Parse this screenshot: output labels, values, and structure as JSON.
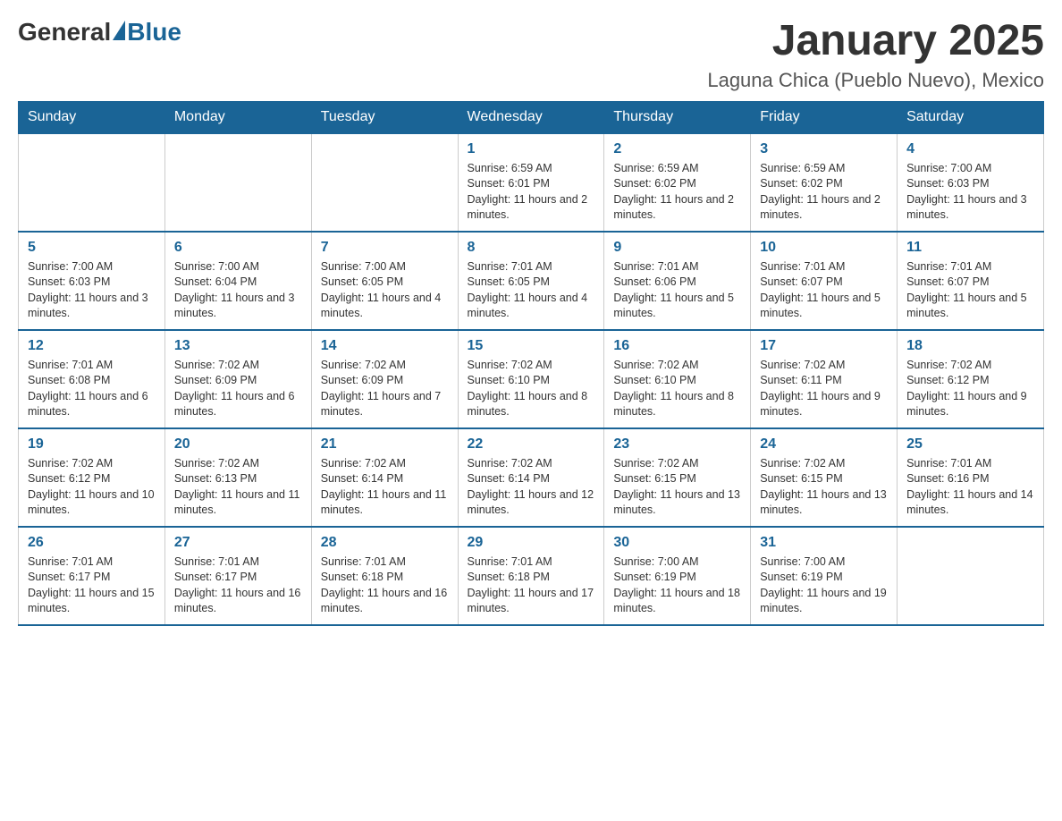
{
  "header": {
    "logo_general": "General",
    "logo_blue": "Blue",
    "title": "January 2025",
    "location": "Laguna Chica (Pueblo Nuevo), Mexico"
  },
  "calendar": {
    "days_of_week": [
      "Sunday",
      "Monday",
      "Tuesday",
      "Wednesday",
      "Thursday",
      "Friday",
      "Saturday"
    ],
    "weeks": [
      [
        {
          "day": "",
          "info": ""
        },
        {
          "day": "",
          "info": ""
        },
        {
          "day": "",
          "info": ""
        },
        {
          "day": "1",
          "info": "Sunrise: 6:59 AM\nSunset: 6:01 PM\nDaylight: 11 hours and 2 minutes."
        },
        {
          "day": "2",
          "info": "Sunrise: 6:59 AM\nSunset: 6:02 PM\nDaylight: 11 hours and 2 minutes."
        },
        {
          "day": "3",
          "info": "Sunrise: 6:59 AM\nSunset: 6:02 PM\nDaylight: 11 hours and 2 minutes."
        },
        {
          "day": "4",
          "info": "Sunrise: 7:00 AM\nSunset: 6:03 PM\nDaylight: 11 hours and 3 minutes."
        }
      ],
      [
        {
          "day": "5",
          "info": "Sunrise: 7:00 AM\nSunset: 6:03 PM\nDaylight: 11 hours and 3 minutes."
        },
        {
          "day": "6",
          "info": "Sunrise: 7:00 AM\nSunset: 6:04 PM\nDaylight: 11 hours and 3 minutes."
        },
        {
          "day": "7",
          "info": "Sunrise: 7:00 AM\nSunset: 6:05 PM\nDaylight: 11 hours and 4 minutes."
        },
        {
          "day": "8",
          "info": "Sunrise: 7:01 AM\nSunset: 6:05 PM\nDaylight: 11 hours and 4 minutes."
        },
        {
          "day": "9",
          "info": "Sunrise: 7:01 AM\nSunset: 6:06 PM\nDaylight: 11 hours and 5 minutes."
        },
        {
          "day": "10",
          "info": "Sunrise: 7:01 AM\nSunset: 6:07 PM\nDaylight: 11 hours and 5 minutes."
        },
        {
          "day": "11",
          "info": "Sunrise: 7:01 AM\nSunset: 6:07 PM\nDaylight: 11 hours and 5 minutes."
        }
      ],
      [
        {
          "day": "12",
          "info": "Sunrise: 7:01 AM\nSunset: 6:08 PM\nDaylight: 11 hours and 6 minutes."
        },
        {
          "day": "13",
          "info": "Sunrise: 7:02 AM\nSunset: 6:09 PM\nDaylight: 11 hours and 6 minutes."
        },
        {
          "day": "14",
          "info": "Sunrise: 7:02 AM\nSunset: 6:09 PM\nDaylight: 11 hours and 7 minutes."
        },
        {
          "day": "15",
          "info": "Sunrise: 7:02 AM\nSunset: 6:10 PM\nDaylight: 11 hours and 8 minutes."
        },
        {
          "day": "16",
          "info": "Sunrise: 7:02 AM\nSunset: 6:10 PM\nDaylight: 11 hours and 8 minutes."
        },
        {
          "day": "17",
          "info": "Sunrise: 7:02 AM\nSunset: 6:11 PM\nDaylight: 11 hours and 9 minutes."
        },
        {
          "day": "18",
          "info": "Sunrise: 7:02 AM\nSunset: 6:12 PM\nDaylight: 11 hours and 9 minutes."
        }
      ],
      [
        {
          "day": "19",
          "info": "Sunrise: 7:02 AM\nSunset: 6:12 PM\nDaylight: 11 hours and 10 minutes."
        },
        {
          "day": "20",
          "info": "Sunrise: 7:02 AM\nSunset: 6:13 PM\nDaylight: 11 hours and 11 minutes."
        },
        {
          "day": "21",
          "info": "Sunrise: 7:02 AM\nSunset: 6:14 PM\nDaylight: 11 hours and 11 minutes."
        },
        {
          "day": "22",
          "info": "Sunrise: 7:02 AM\nSunset: 6:14 PM\nDaylight: 11 hours and 12 minutes."
        },
        {
          "day": "23",
          "info": "Sunrise: 7:02 AM\nSunset: 6:15 PM\nDaylight: 11 hours and 13 minutes."
        },
        {
          "day": "24",
          "info": "Sunrise: 7:02 AM\nSunset: 6:15 PM\nDaylight: 11 hours and 13 minutes."
        },
        {
          "day": "25",
          "info": "Sunrise: 7:01 AM\nSunset: 6:16 PM\nDaylight: 11 hours and 14 minutes."
        }
      ],
      [
        {
          "day": "26",
          "info": "Sunrise: 7:01 AM\nSunset: 6:17 PM\nDaylight: 11 hours and 15 minutes."
        },
        {
          "day": "27",
          "info": "Sunrise: 7:01 AM\nSunset: 6:17 PM\nDaylight: 11 hours and 16 minutes."
        },
        {
          "day": "28",
          "info": "Sunrise: 7:01 AM\nSunset: 6:18 PM\nDaylight: 11 hours and 16 minutes."
        },
        {
          "day": "29",
          "info": "Sunrise: 7:01 AM\nSunset: 6:18 PM\nDaylight: 11 hours and 17 minutes."
        },
        {
          "day": "30",
          "info": "Sunrise: 7:00 AM\nSunset: 6:19 PM\nDaylight: 11 hours and 18 minutes."
        },
        {
          "day": "31",
          "info": "Sunrise: 7:00 AM\nSunset: 6:19 PM\nDaylight: 11 hours and 19 minutes."
        },
        {
          "day": "",
          "info": ""
        }
      ]
    ]
  }
}
